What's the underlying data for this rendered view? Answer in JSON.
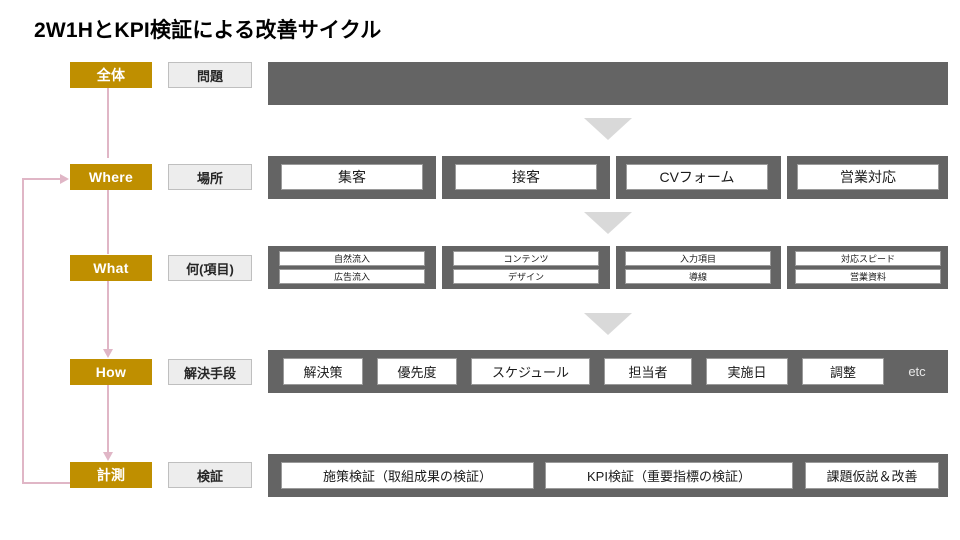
{
  "title": "2W1HとKPI検証による改善サイクル",
  "colors": {
    "stage_chip": "#BF8F00",
    "kind_chip": "#EDEDED",
    "band": "#646464",
    "arrow": "#D9D9D9",
    "flow_line": "#E0B6C6",
    "item_box": "#FFFFFF"
  },
  "rows": [
    {
      "stage": "全体",
      "kind": "問題",
      "items": []
    },
    {
      "stage": "Where",
      "kind": "場所",
      "items": [
        "集客",
        "接客",
        "CVフォーム",
        "営業対応"
      ]
    },
    {
      "stage": "What",
      "kind": "何(項目)",
      "groups": [
        [
          "自然流入",
          "広告流入"
        ],
        [
          "コンテンツ",
          "デザイン"
        ],
        [
          "入力項目",
          "導線"
        ],
        [
          "対応スピード",
          "営業資料"
        ]
      ]
    },
    {
      "stage": "How",
      "kind": "解決手段",
      "items": [
        "解決策",
        "優先度",
        "スケジュール",
        "担当者",
        "実施日",
        "調整"
      ],
      "trailing_label": "etc"
    },
    {
      "stage": "計測",
      "kind": "検証",
      "items": [
        "施策検証（取組成果の検証）",
        "KPI検証（重要指標の検証）",
        "課題仮説＆改善"
      ]
    }
  ]
}
